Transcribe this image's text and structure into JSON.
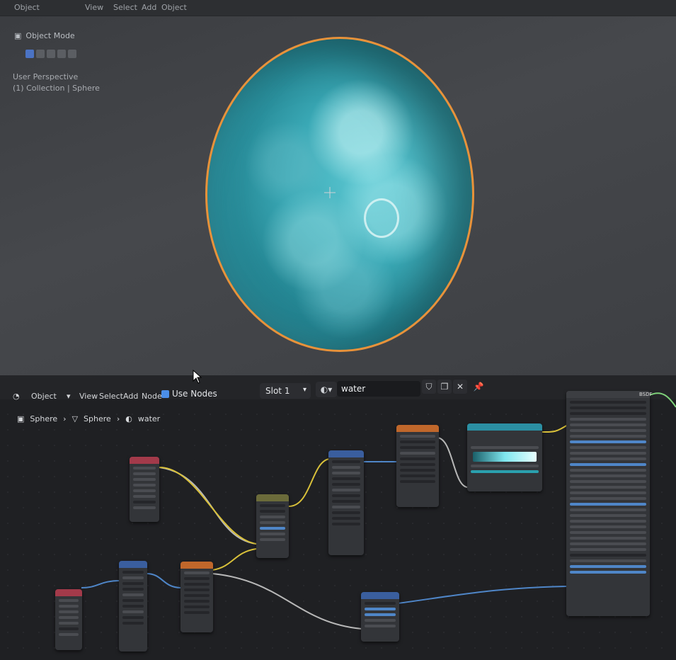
{
  "viewport": {
    "header_items": [
      "Object",
      "View",
      "Select",
      "Add",
      "Object"
    ],
    "toolbar_label": "Object Mode",
    "overlay_line1": "User Perspective",
    "overlay_line2": "(1) Collection | Sphere"
  },
  "node_editor": {
    "editor_type_icon": "shader-editor-icon",
    "mode": "Object",
    "menus": [
      "View",
      "Select",
      "Add",
      "Node"
    ],
    "use_nodes_label": "Use Nodes",
    "use_nodes_checked": true,
    "slot": "Slot 1",
    "material_name": "water",
    "breadcrumb": [
      "Sphere",
      "Sphere",
      "water"
    ],
    "output_socket_label": "BSDF"
  },
  "colors": {
    "selection_outline": "#e8923a",
    "planet": "#3aa9b6",
    "wire_yellow": "#d9c13a",
    "wire_blue": "#4f86c8",
    "wire_gray": "#b8b8b8",
    "wire_green": "#7fd37a",
    "node_header_red": "#a33a4a",
    "node_header_blue": "#3a5e9e",
    "node_header_orange": "#c0672b",
    "node_header_olive": "#6b6b3a",
    "node_header_teal": "#2b8fa3"
  }
}
